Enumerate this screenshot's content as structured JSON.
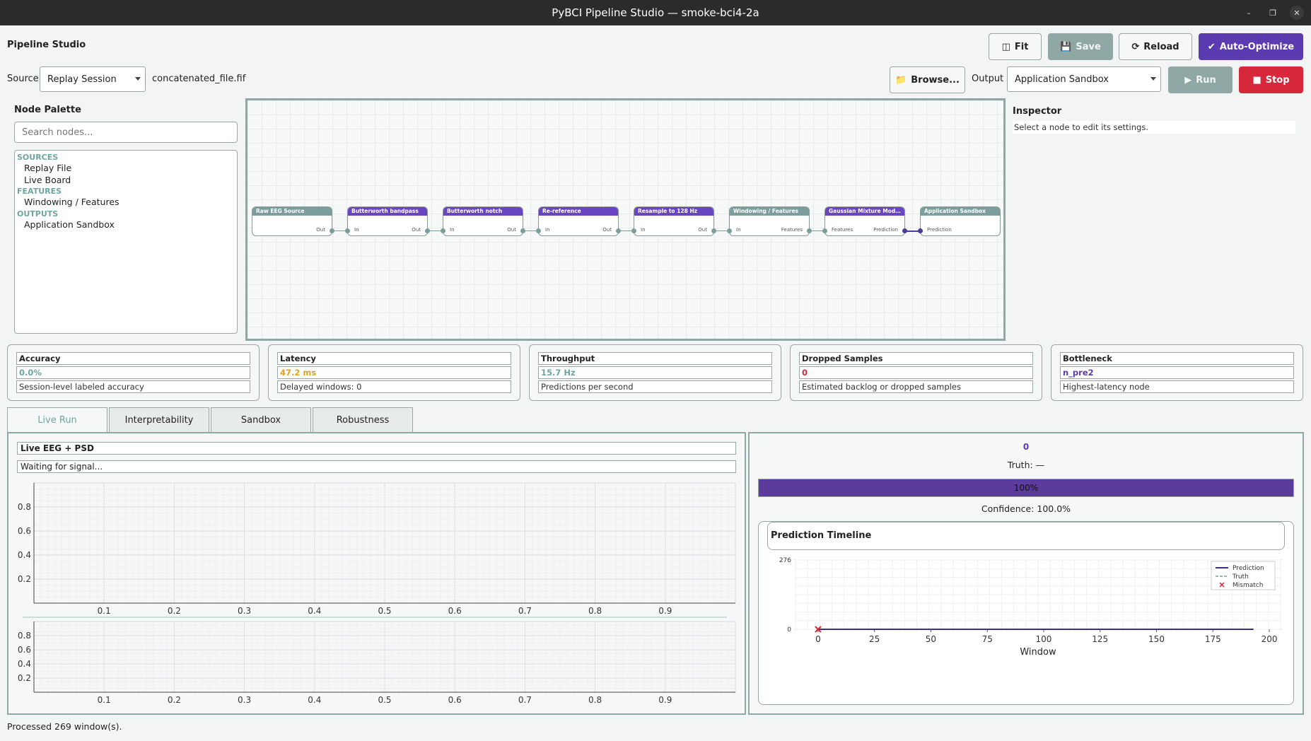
{
  "window": {
    "title": "PyBCI Pipeline Studio — smoke-bci4-2a"
  },
  "app": {
    "title": "Pipeline Studio"
  },
  "toolbar": {
    "fit": "Fit",
    "save": "Save",
    "reload": "Reload",
    "auto_optimize": "Auto-Optimize"
  },
  "source": {
    "label": "Source",
    "value": "Replay Session",
    "file": "concatenated_file.fif",
    "browse": "Browse..."
  },
  "output": {
    "label": "Output",
    "value": "Application Sandbox",
    "run": "Run",
    "stop": "Stop"
  },
  "palette": {
    "title": "Node Palette",
    "search_placeholder": "Search nodes...",
    "groups": [
      {
        "label": "SOURCES",
        "items": [
          "Replay File",
          "Live Board"
        ]
      },
      {
        "label": "FEATURES",
        "items": [
          "Windowing / Features"
        ]
      },
      {
        "label": "OUTPUTS",
        "items": [
          "Application Sandbox"
        ]
      }
    ]
  },
  "nodes": [
    {
      "title": "Raw EEG Source",
      "in": "",
      "out": "Out",
      "color": "#7b9e9c"
    },
    {
      "title": "Butterworth bandpass",
      "in": "In",
      "out": "Out",
      "color": "#6a45c2"
    },
    {
      "title": "Butterworth notch",
      "in": "In",
      "out": "Out",
      "color": "#6a45c2"
    },
    {
      "title": "Re-reference",
      "in": "In",
      "out": "Out",
      "color": "#6a45c2"
    },
    {
      "title": "Resample to 128 Hz",
      "in": "In",
      "out": "Out",
      "color": "#6a45c2"
    },
    {
      "title": "Windowing / Features",
      "in": "In",
      "out": "Features",
      "color": "#7b9e9c"
    },
    {
      "title": "Gaussian Mixture Model ...",
      "in": "Features",
      "out": "Prediction",
      "color": "#6a45c2"
    },
    {
      "title": "Application Sandbox",
      "in": "Prediction",
      "out": "",
      "color": "#7b9e9c"
    }
  ],
  "inspector": {
    "title": "Inspector",
    "hint": "Select a node to edit its settings."
  },
  "metrics": [
    {
      "title": "Accuracy",
      "value": "0.0%",
      "desc": "Session-level labeled accuracy",
      "color": "#6fa5a0"
    },
    {
      "title": "Latency",
      "value": "47.2 ms",
      "desc": "Delayed windows: 0",
      "color": "#e0a020"
    },
    {
      "title": "Throughput",
      "value": "15.7 Hz",
      "desc": "Predictions per second",
      "color": "#6fa5a0"
    },
    {
      "title": "Dropped Samples",
      "value": "0",
      "desc": "Estimated backlog or dropped samples",
      "color": "#d6283a"
    },
    {
      "title": "Bottleneck",
      "value": "n_pre2",
      "desc": "Highest-latency node",
      "color": "#5b3bb0"
    }
  ],
  "tabs": [
    "Live Run",
    "Interpretability",
    "Sandbox",
    "Robustness"
  ],
  "live": {
    "title": "Live EEG + PSD",
    "status": "Waiting for signal..."
  },
  "prediction": {
    "value": "0",
    "truth": "Truth: —",
    "progress_text": "100%",
    "progress": 1.0,
    "confidence": "Confidence: 100.0%"
  },
  "timeline": {
    "title": "Prediction Timeline"
  },
  "chart_data": [
    {
      "type": "line",
      "title": "",
      "x_ticks": [
        "0.1",
        "0.2",
        "0.3",
        "0.4",
        "0.5",
        "0.6",
        "0.7",
        "0.8",
        "0.9"
      ],
      "y_ticks": [
        "0.2",
        "0.4",
        "0.6",
        "0.8"
      ],
      "xlim": [
        0,
        1
      ],
      "ylim": [
        0,
        1
      ],
      "grid": true,
      "series": []
    },
    {
      "type": "line",
      "title": "",
      "x_ticks": [
        "0.1",
        "0.2",
        "0.3",
        "0.4",
        "0.5",
        "0.6",
        "0.7",
        "0.8",
        "0.9"
      ],
      "y_ticks": [
        "0.2",
        "0.4",
        "0.6",
        "0.8"
      ],
      "xlim": [
        0,
        1
      ],
      "ylim": [
        0,
        1
      ],
      "grid": true,
      "series": []
    },
    {
      "type": "line",
      "title": "Prediction Timeline",
      "xlabel": "Window",
      "x_ticks": [
        "0",
        "25",
        "50",
        "75",
        "100",
        "125",
        "150",
        "175",
        "200"
      ],
      "y_ticks": [
        "0",
        "276"
      ],
      "xlim": [
        -10,
        205
      ],
      "ylim": [
        0,
        276
      ],
      "grid": true,
      "legend": {
        "placement": "top-right",
        "entries": [
          "Prediction",
          "Truth",
          "Mismatch"
        ]
      },
      "series": [
        {
          "name": "Prediction",
          "x": [
            0,
            193
          ],
          "y": [
            0,
            0
          ],
          "color": "#3a2f8f"
        },
        {
          "name": "Truth",
          "x": [],
          "y": [],
          "color": "#7b9e9c"
        },
        {
          "name": "Mismatch",
          "x": [
            0
          ],
          "y": [
            0
          ],
          "color": "#d6283a"
        }
      ]
    }
  ],
  "status": {
    "text": "Processed 269 window(s)."
  }
}
